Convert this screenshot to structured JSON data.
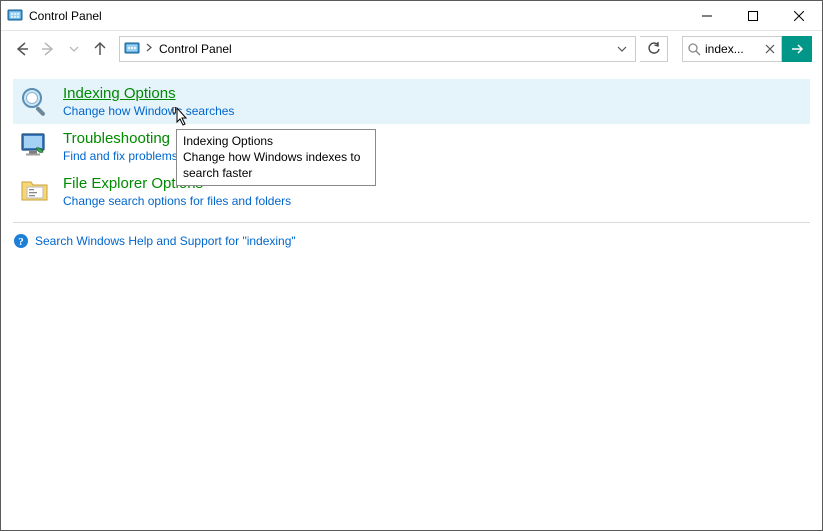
{
  "window": {
    "title": "Control Panel"
  },
  "address": {
    "crumb": "Control Panel"
  },
  "search": {
    "display_text": "index..."
  },
  "results": [
    {
      "title": "Indexing Options",
      "desc": "Change how Windows searches",
      "icon": "magnifier"
    },
    {
      "title": "Troubleshooting",
      "desc": "Find and fix problems",
      "icon": "monitor"
    },
    {
      "title": "File Explorer Options",
      "desc": "Change search options for files and folders",
      "icon": "folder-options"
    }
  ],
  "help": {
    "text": "Search Windows Help and Support for \"indexing\""
  },
  "tooltip": {
    "title": "Indexing Options",
    "body": "Change how Windows indexes to search faster"
  }
}
